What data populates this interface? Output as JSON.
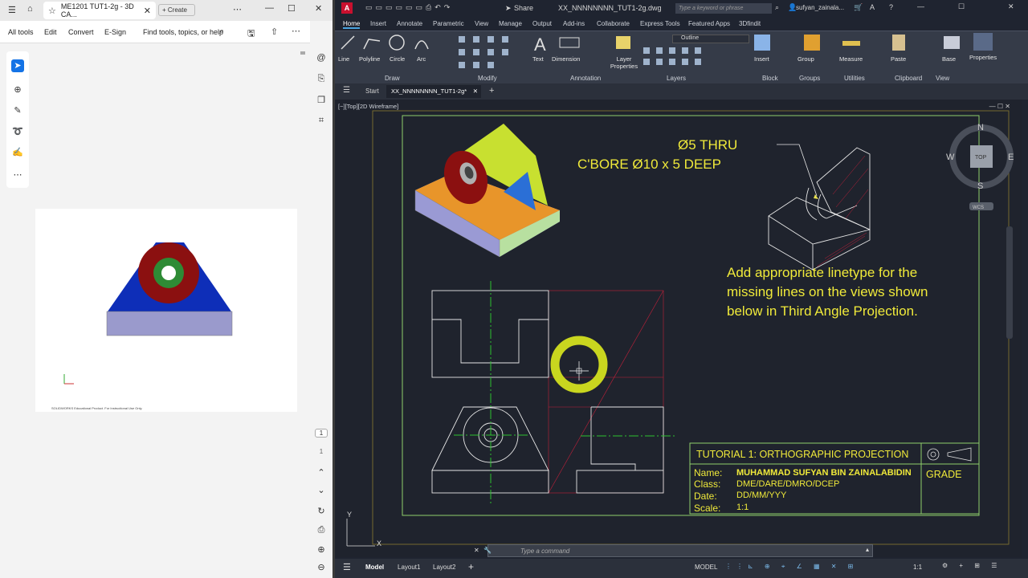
{
  "pdf": {
    "tab_title": "ME1201 TUT1-2g - 3D CA...",
    "create_label": "Create",
    "menu": [
      "All tools",
      "Edit",
      "Convert",
      "E-Sign"
    ],
    "search_label": "Find tools, topics, or help",
    "page_number": "1",
    "page_total": "1",
    "watermark": "SOLIDWORKS Educational Product. For Instructional Use Only."
  },
  "cad": {
    "file_title": "XX_NNNNNNNN_TUT1-2g.dwg",
    "share_label": "Share",
    "search_placeholder": "Type a keyword or phrase",
    "user": "sufyan_zainala...",
    "ribbon_tabs": [
      "Home",
      "Insert",
      "Annotate",
      "Parametric",
      "View",
      "Manage",
      "Output",
      "Add-ins",
      "Collaborate",
      "Express Tools",
      "Featured Apps",
      "3Dfindit"
    ],
    "draw_tools": [
      "Line",
      "Polyline",
      "Circle",
      "Arc"
    ],
    "ribbon_buttons": {
      "text": "Text",
      "dimension": "Dimension",
      "layer_props": "Layer Properties",
      "insert": "Insert",
      "group": "Group",
      "measure": "Measure",
      "paste": "Paste",
      "base": "Base",
      "properties": "Properties"
    },
    "layer_name": "Outline",
    "panels": [
      "Draw",
      "Modify",
      "Annotation",
      "Layers",
      "Block",
      "Groups",
      "Utilities",
      "Clipboard",
      "View"
    ],
    "doc_tabs": {
      "start": "Start",
      "active": "XX_NNNNNNNN_TUT1-2g*"
    },
    "view_label": "[−][Top][2D Wireframe]",
    "compass": {
      "n": "N",
      "s": "S",
      "e": "E",
      "w": "W",
      "top": "TOP",
      "wcs": "WCS"
    },
    "note_thru": "Ø5 THRU",
    "note_cbore": "C'BORE Ø10 x 5 DEEP",
    "instruction_lines": [
      "Add appropriate linetype for the",
      "missing lines on the views shown",
      "below in Third Angle Projection."
    ],
    "title_block": {
      "title": "TUTORIAL 1: ORTHOGRAPHIC PROJECTION",
      "grade": "GRADE",
      "labels": [
        "Name:",
        "Class:",
        "Date:",
        "Scale:"
      ],
      "values": [
        "MUHAMMAD SUFYAN BIN ZAINALABIDIN",
        "DME/DARE/DMRO/DCEP",
        "DD/MM/YYY",
        "1:1"
      ]
    },
    "cmd_placeholder": "Type a command",
    "layout_tabs": [
      "Model",
      "Layout1",
      "Layout2"
    ],
    "status_model": "MODEL",
    "status_scale": "1:1",
    "axis_y": "Y",
    "axis_x": "X"
  }
}
